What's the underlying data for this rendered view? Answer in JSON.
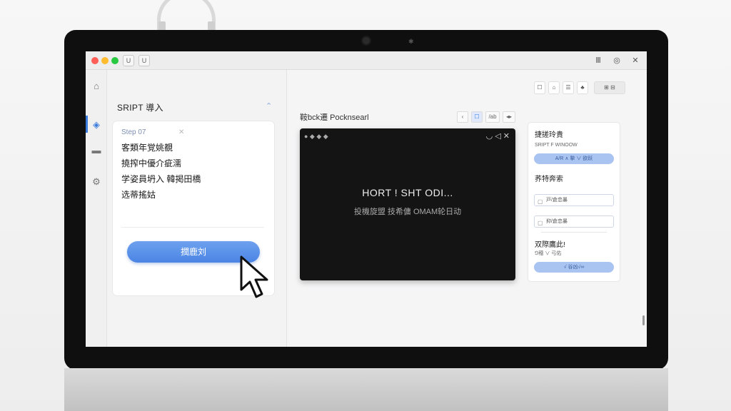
{
  "titlebar": {
    "left_buttons": [
      "U",
      "U"
    ],
    "right_buttons": [
      "Ⅲ",
      "◎",
      "✕"
    ]
  },
  "left_panel": {
    "title": "SRIPT 導入",
    "step_label": "Step 07",
    "step_extra": "✕",
    "lines": [
      "客類年覚姚覩",
      "撓搾中優介疵濡",
      "学姿員坍入 韓掲田橋",
      "选蒂搖姑"
    ],
    "primary_button": "撋鹿刘"
  },
  "toolbar_right": {
    "buttons": [
      "☐ ⌂",
      "☰",
      "♣",
      "⊞ ⊟"
    ]
  },
  "center": {
    "title": "鞍bck遷 Pocknsearl",
    "segments": [
      "‹",
      "☐",
      "/ab",
      "◂▸"
    ],
    "preview": {
      "heading": "HORT ! SHT ODI...",
      "subtitle": "投機旋盟 技希傭 OMAM轮日动"
    }
  },
  "right_card": {
    "h1": "捷搓玲貴",
    "s1": "SRIPT F WINOOW",
    "pill1": "A/R ∧ 摯 ∨ 欲跃",
    "h2": "荞特奔索",
    "field1": "戸/倉恋暴",
    "field2": "抑/倉恋暴",
    "h3": "双際鷹此!",
    "s3": "⅁穂 ∨ 弓佑",
    "pill2": "√ 谷凶√∞"
  },
  "rail_icons": [
    "home-icon",
    "palette-icon",
    "folder-icon",
    "gear-icon",
    "heart-icon"
  ],
  "colors": {
    "accent": "#4a84e4",
    "pill": "#a9c4f0",
    "preview_bg": "#141414"
  }
}
